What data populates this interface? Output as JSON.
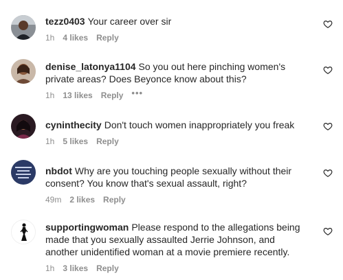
{
  "comments": [
    {
      "username": "tezz0403",
      "text": "Your career over sir",
      "time": "1h",
      "likes": "4 likes",
      "reply": "Reply",
      "avatar_icon": "avatar-man-icon"
    },
    {
      "username": "denise_latonya1104",
      "text": "So you out here pinching women's private areas? Does Beyonce know about this?",
      "time": "1h",
      "likes": "13 likes",
      "reply": "Reply",
      "more": "•••",
      "avatar_icon": "avatar-woman-icon"
    },
    {
      "username": "cyninthecity",
      "text": "Don't touch women inappropriately you freak",
      "time": "1h",
      "likes": "5 likes",
      "reply": "Reply",
      "avatar_icon": "avatar-woman-icon"
    },
    {
      "username": "nbdot",
      "text": "Why are you touching people sexually without their consent? You know that's sexual assault, right?",
      "time": "49m",
      "likes": "2 likes",
      "reply": "Reply",
      "avatar_icon": "avatar-graphic-icon"
    },
    {
      "username": "supportingwoman",
      "text": "Please respond to the allegations being made that you sexually assaulted Jerrie Johnson, and another unidentified woman at a movie premiere recently.",
      "time": "1h",
      "likes": "3 likes",
      "reply": "Reply",
      "avatar_icon": "avatar-silhouette-icon"
    }
  ],
  "colors": {
    "text": "#262626",
    "meta": "#8e8e8e",
    "background": "#ffffff"
  },
  "icons": {
    "like": "heart-outline-icon"
  }
}
